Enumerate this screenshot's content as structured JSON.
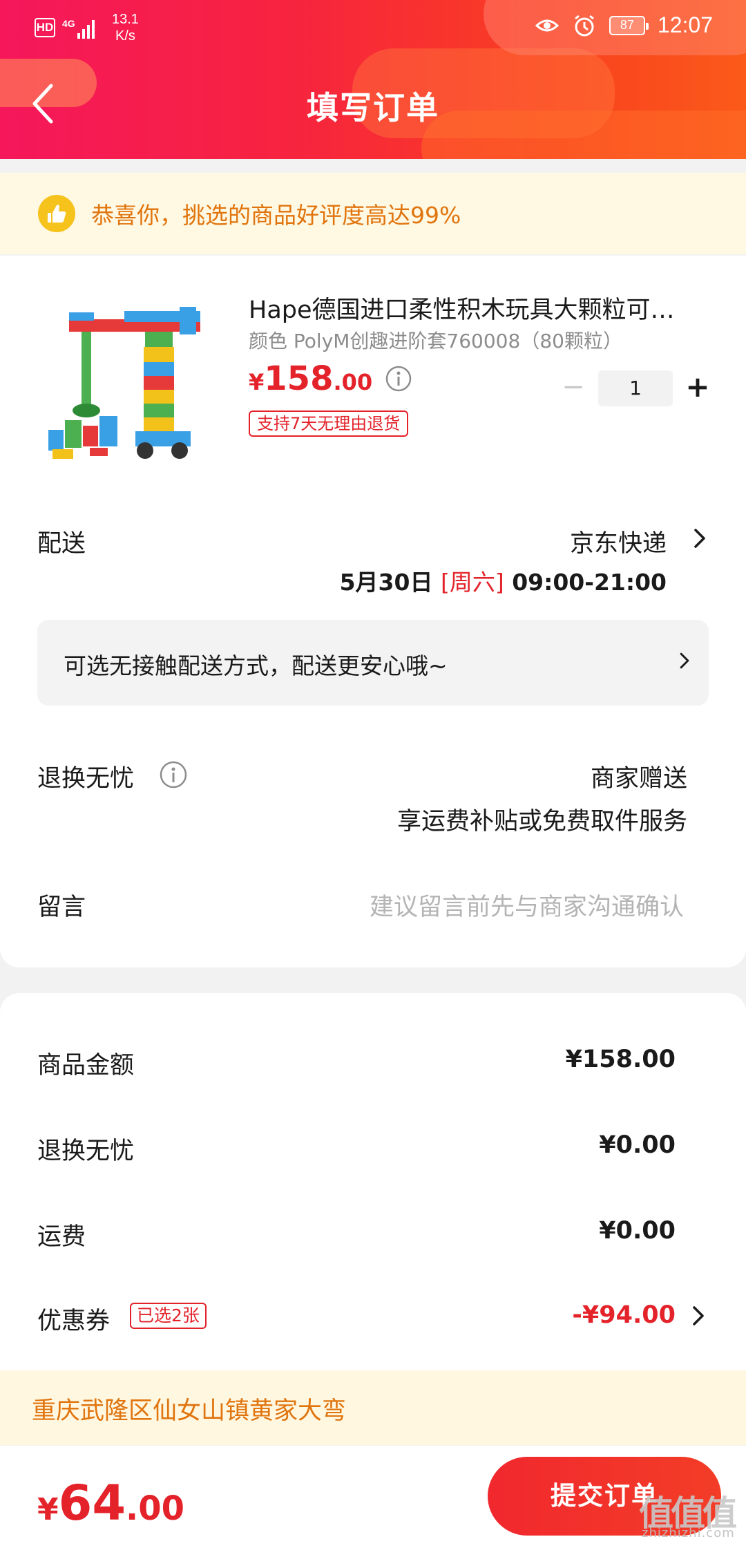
{
  "status_bar": {
    "hd": "HD",
    "network": "4G",
    "speed_value": "13.1",
    "speed_unit": "K/s",
    "battery": "87",
    "time": "12:07"
  },
  "header": {
    "title": "填写订单"
  },
  "praise_banner": {
    "text": "恭喜你，挑选的商品好评度高达99%"
  },
  "product": {
    "title": "Hape德国进口柔性积木玩具大颗粒可…",
    "spec": "颜色 PolyM创趣进阶套760008（80颗粒）",
    "price_currency": "¥",
    "price_int": "158",
    "price_dec": ".00",
    "return_tag": "支持7天无理由退货",
    "quantity": "1",
    "qty_minus": "−",
    "qty_plus": "+"
  },
  "delivery": {
    "label": "配送",
    "method": "京东快递",
    "date": "5月30日",
    "weekday": "[周六]",
    "time_range": "09:00-21:00"
  },
  "contactless": {
    "text": "可选无接触配送方式，配送更安心哦~"
  },
  "worry_free": {
    "label": "退换无忧",
    "value_line1": "商家赠送",
    "value_line2": "享运费补贴或免费取件服务"
  },
  "message": {
    "label": "留言",
    "placeholder": "建议留言前先与商家沟通确认"
  },
  "summary": {
    "goods_amount_label": "商品金额",
    "goods_amount": "¥158.00",
    "worry_label": "退换无忧",
    "worry_amount": "¥0.00",
    "shipping_label": "运费",
    "shipping_amount": "¥0.00",
    "coupon_label": "优惠券",
    "coupon_tag": "已选2张",
    "coupon_amount": "-¥94.00"
  },
  "address": {
    "text": "重庆武隆区仙女山镇黄家大弯"
  },
  "bottom_bar": {
    "total_currency": "¥",
    "total_int": "64",
    "total_dec": ".00",
    "submit_label": "提交订单"
  },
  "watermark": {
    "glyphs": "值值值",
    "site": "zhizhizhi.com"
  },
  "colors": {
    "header_gradient_start": "#f5175b",
    "header_gradient_end": "#fb5a1a",
    "price_red": "#e4222a",
    "banner_orange": "#e0740d",
    "banner_bg": "#fff8e2"
  },
  "icons": {
    "back": "back-arrow-icon",
    "thumb": "thumbs-up-icon",
    "info": "info-icon",
    "chevron": "chevron-right-icon",
    "eye": "eye-icon",
    "alarm": "alarm-clock-icon"
  }
}
